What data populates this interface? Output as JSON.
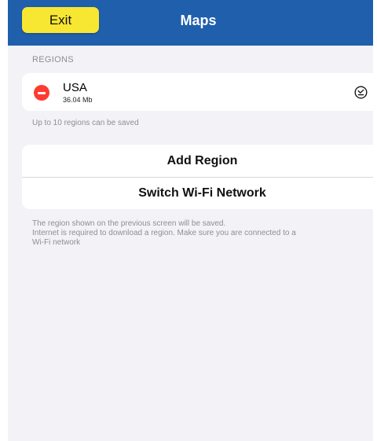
{
  "navbar": {
    "exit_label": "Exit",
    "title": "Maps"
  },
  "regions_section": {
    "header": "REGIONS",
    "items": [
      {
        "name": "USA",
        "size": "36.04 Mb",
        "delete_icon": "minus-circle-icon",
        "status_icon": "checkmark-circle-icon"
      }
    ],
    "footnote": "Up to 10 regions can be saved"
  },
  "actions": {
    "add_region_label": "Add Region",
    "switch_wifi_label": "Switch Wi-Fi Network"
  },
  "info": {
    "line1": "The region shown on the previous screen will be saved.",
    "line2": "Internet is required to download a region. Make sure you are connected to a",
    "line3": "Wi-Fi network"
  },
  "colors": {
    "navbar": "#1f5fac",
    "exit_button": "#f7e733",
    "background": "#f2f2f7",
    "delete_red": "#ff3b30",
    "secondary_text": "#8e8e93"
  }
}
